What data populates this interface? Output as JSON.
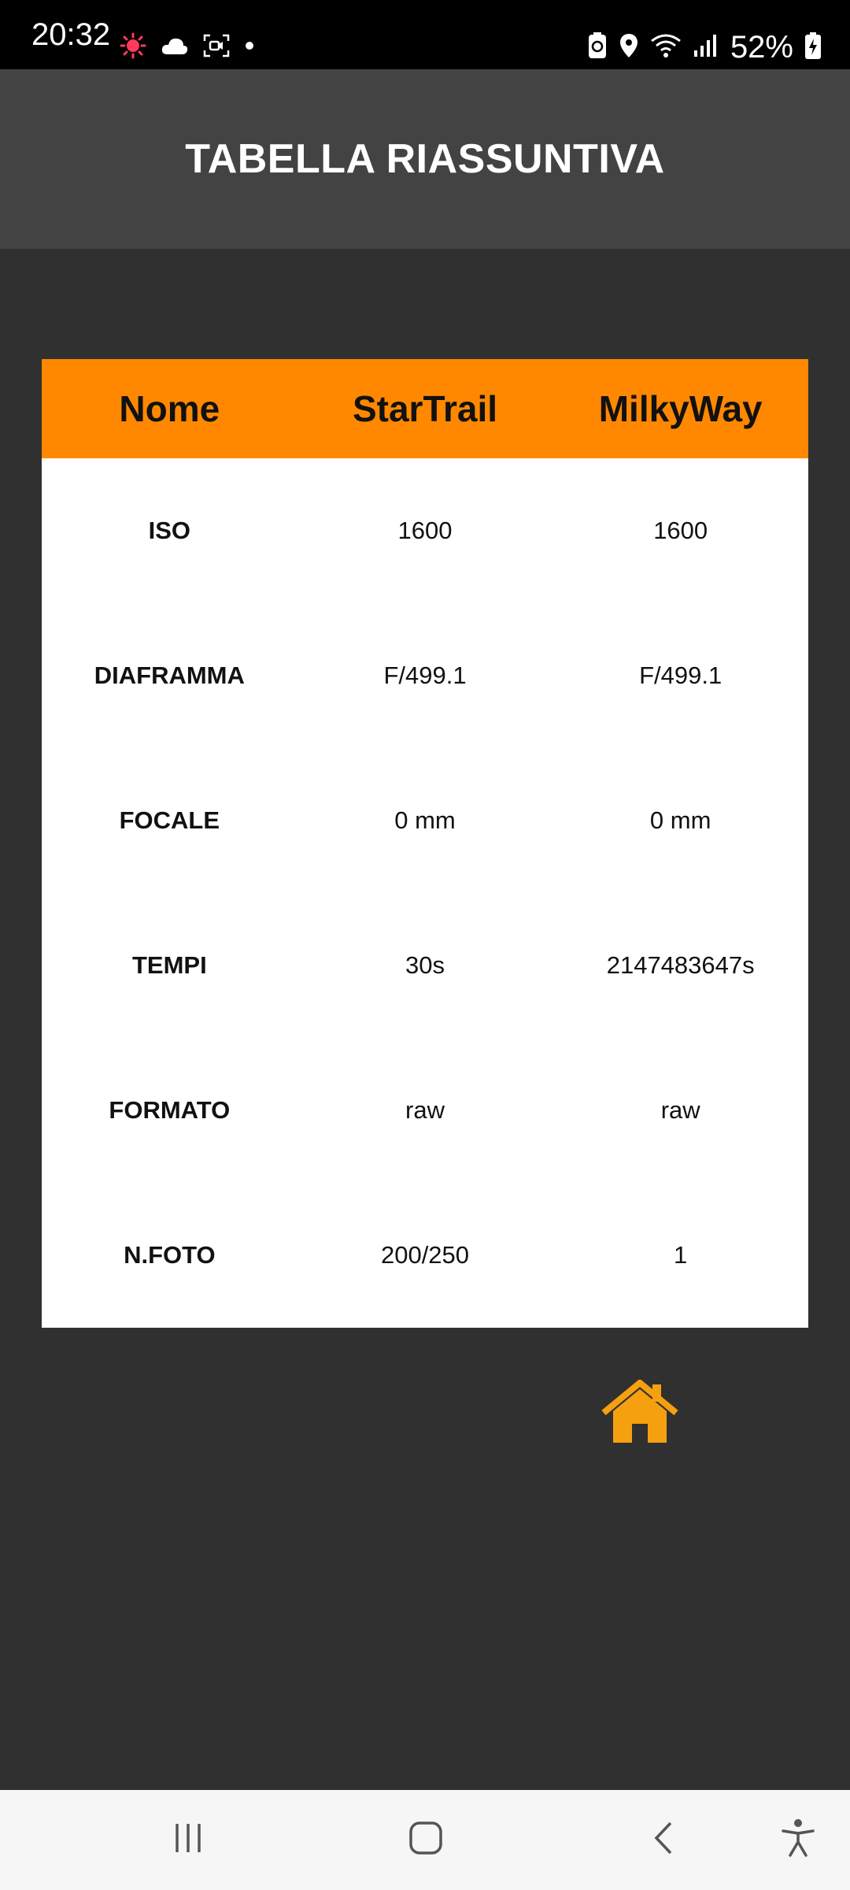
{
  "status_bar": {
    "time": "20:32",
    "battery_percent": "52%",
    "icons_left": [
      "weather-sun-icon",
      "cloud-icon",
      "screen-record-icon",
      "notification-dot-icon"
    ],
    "icons_right": [
      "battery-saver-icon",
      "location-icon",
      "wifi-icon",
      "signal-icon",
      "battery-icon"
    ]
  },
  "header": {
    "title": "TABELLA RIASSUNTIVA",
    "background": "#434343"
  },
  "table": {
    "header_color": "#ff8800",
    "columns": [
      "Nome",
      "StarTrail",
      "MilkyWay"
    ],
    "rows": [
      {
        "label": "ISO",
        "startrail": "1600",
        "milkyway": "1600"
      },
      {
        "label": "DIAFRAMMA",
        "startrail": "F/499.1",
        "milkyway": "F/499.1"
      },
      {
        "label": "FOCALE",
        "startrail": "0 mm",
        "milkyway": "0 mm"
      },
      {
        "label": "TEMPI",
        "startrail": "30s",
        "milkyway": "2147483647s"
      },
      {
        "label": "FORMATO",
        "startrail": "raw",
        "milkyway": "raw"
      },
      {
        "label": "N.FOTO",
        "startrail": "200/250",
        "milkyway": "1"
      }
    ]
  },
  "home_button": {
    "icon": "home-icon",
    "color": "#f5a00f"
  },
  "nav_bar": {
    "items": [
      "recent-apps-icon",
      "home-nav-icon",
      "back-icon",
      "accessibility-icon"
    ]
  }
}
